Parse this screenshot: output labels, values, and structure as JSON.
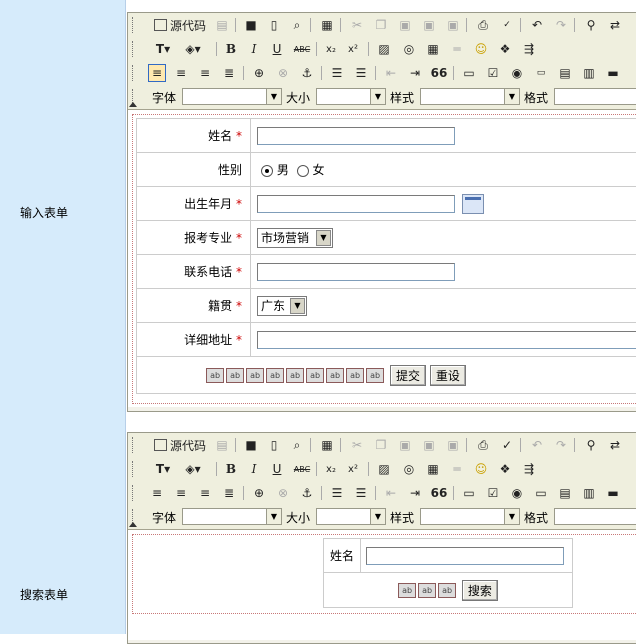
{
  "sections": {
    "input_form_label": "输入表单",
    "search_form_label": "搜索表单"
  },
  "toolbar": {
    "source_label": "源代码",
    "font_label": "字体",
    "size_label": "大小",
    "style_label": "样式",
    "format_label": "格式",
    "row1_icons": [
      "source-icon",
      "paste-text-icon",
      "save-icon",
      "new-page-icon",
      "preview-icon",
      "template-icon",
      "cut-icon",
      "copy-icon",
      "paste-icon",
      "paste-word-icon",
      "paste-plain-icon",
      "print-icon",
      "spellcheck-icon",
      "undo-icon",
      "redo-icon",
      "find-icon",
      "replace-icon"
    ],
    "row2_icons": [
      "text-color-icon",
      "bg-color-icon",
      "bold-icon",
      "italic-icon",
      "underline-icon",
      "strike-icon",
      "subscript-icon",
      "superscript-icon",
      "image-icon",
      "flash-icon",
      "table-icon",
      "hr-icon",
      "smiley-icon",
      "special-char-icon",
      "page-break-icon"
    ],
    "row3_icons": [
      "align-left-icon",
      "align-center-icon",
      "align-right-icon",
      "justify-icon",
      "link-icon",
      "unlink-icon",
      "anchor-icon",
      "ordered-list-icon",
      "unordered-list-icon",
      "outdent-icon",
      "indent-icon",
      "blockquote-icon",
      "form-icon",
      "checkbox-icon",
      "radio-icon",
      "textfield-icon",
      "textarea-icon",
      "select-icon",
      "button-icon"
    ],
    "glyphs": {
      "bold": "B",
      "italic": "I",
      "underline": "U",
      "strike": "ABC",
      "subscript": "x₂",
      "superscript": "x²",
      "quote": "66"
    }
  },
  "input_form": {
    "name_label": "姓名",
    "gender_label": "性别",
    "gender_male": "男",
    "gender_female": "女",
    "birth_label": "出生年月",
    "major_label": "报考专业",
    "major_value": "市场营销",
    "phone_label": "联系电话",
    "hometown_label": "籍贯",
    "hometown_value": "广东",
    "address_label": "详细地址",
    "required_mark": "*",
    "submit_label": "提交",
    "reset_label": "重设",
    "hidden_field_glyph": "ab"
  },
  "search_form": {
    "name_label": "姓名",
    "search_label": "搜索",
    "hidden_field_glyph": "ab"
  }
}
